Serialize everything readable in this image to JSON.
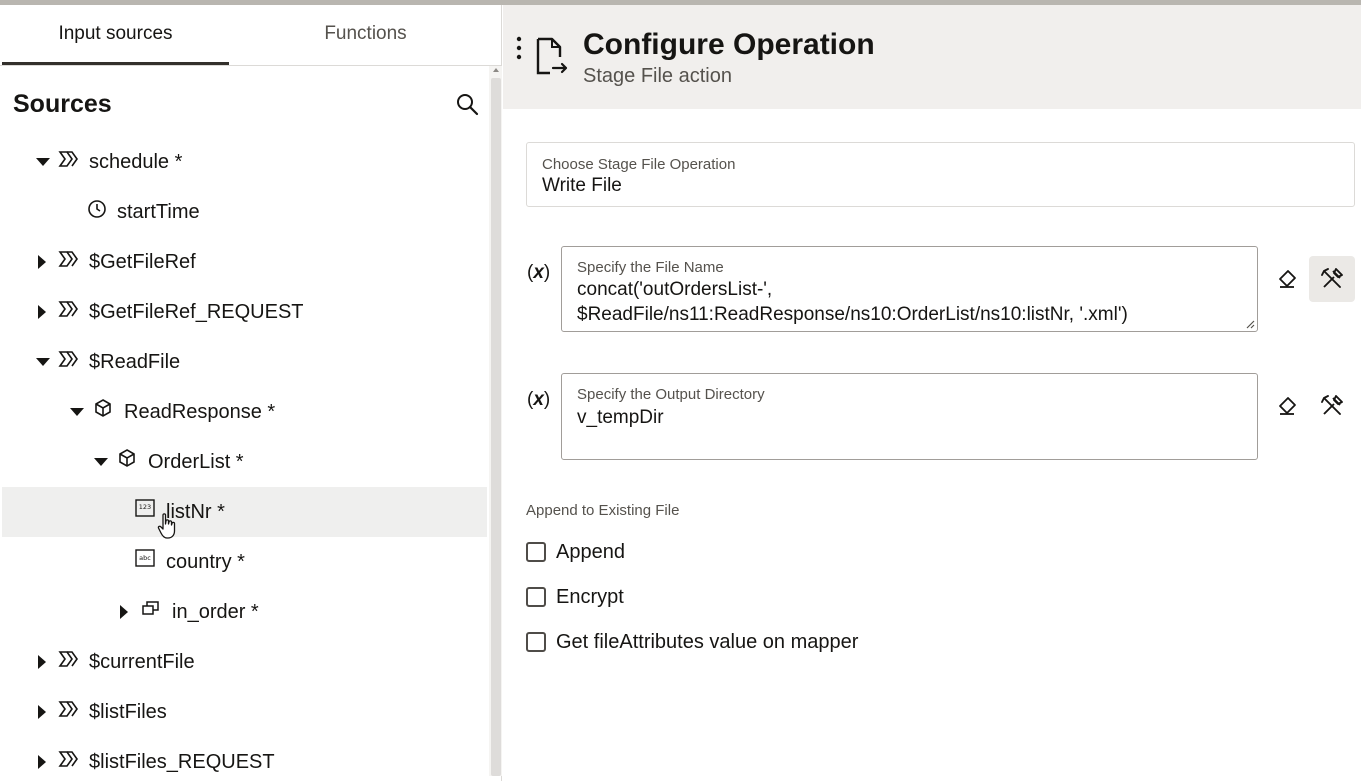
{
  "tabs": [
    {
      "label": "Input sources",
      "active": true
    },
    {
      "label": "Functions",
      "active": false
    }
  ],
  "sources": {
    "title": "Sources",
    "tree": [
      {
        "label": "schedule *",
        "icon": "schema-icon",
        "expander": "expanded"
      },
      {
        "label": "startTime",
        "icon": "clock-icon",
        "expander": "none"
      },
      {
        "label": "$GetFileRef",
        "icon": "schema-icon",
        "expander": "collapsed"
      },
      {
        "label": "$GetFileRef_REQUEST",
        "icon": "schema-icon",
        "expander": "collapsed"
      },
      {
        "label": "$ReadFile",
        "icon": "schema-icon",
        "expander": "expanded"
      },
      {
        "label": "ReadResponse *",
        "icon": "cube-icon",
        "expander": "expanded"
      },
      {
        "label": "OrderList *",
        "icon": "cube-icon",
        "expander": "expanded"
      },
      {
        "label": "listNr *",
        "icon": "number-icon",
        "expander": "none",
        "selected": true
      },
      {
        "label": "country *",
        "icon": "string-icon",
        "expander": "none"
      },
      {
        "label": "in_order *",
        "icon": "repeating-icon",
        "expander": "collapsed"
      },
      {
        "label": "$currentFile",
        "icon": "schema-icon",
        "expander": "collapsed"
      },
      {
        "label": "$listFiles",
        "icon": "schema-icon",
        "expander": "collapsed"
      },
      {
        "label": "$listFiles_REQUEST",
        "icon": "schema-icon",
        "expander": "collapsed"
      }
    ]
  },
  "header": {
    "title": "Configure Operation",
    "subtitle": "Stage File action"
  },
  "operation": {
    "label": "Choose Stage File Operation",
    "value": "Write File"
  },
  "file_name": {
    "x_label": "x",
    "label": "Specify the File Name",
    "line1": "concat('outOrdersList-',",
    "line2": "$ReadFile/ns11:ReadResponse/ns10:OrderList/ns10:listNr, '.xml')"
  },
  "output_dir": {
    "x_label": "x",
    "label": "Specify the Output Directory",
    "value": "v_tempDir"
  },
  "append_section": {
    "label": "Append to Existing File",
    "checkboxes": [
      {
        "label": "Append",
        "checked": false
      },
      {
        "label": "Encrypt",
        "checked": false
      },
      {
        "label": "Get fileAttributes value on mapper",
        "checked": false
      }
    ]
  }
}
